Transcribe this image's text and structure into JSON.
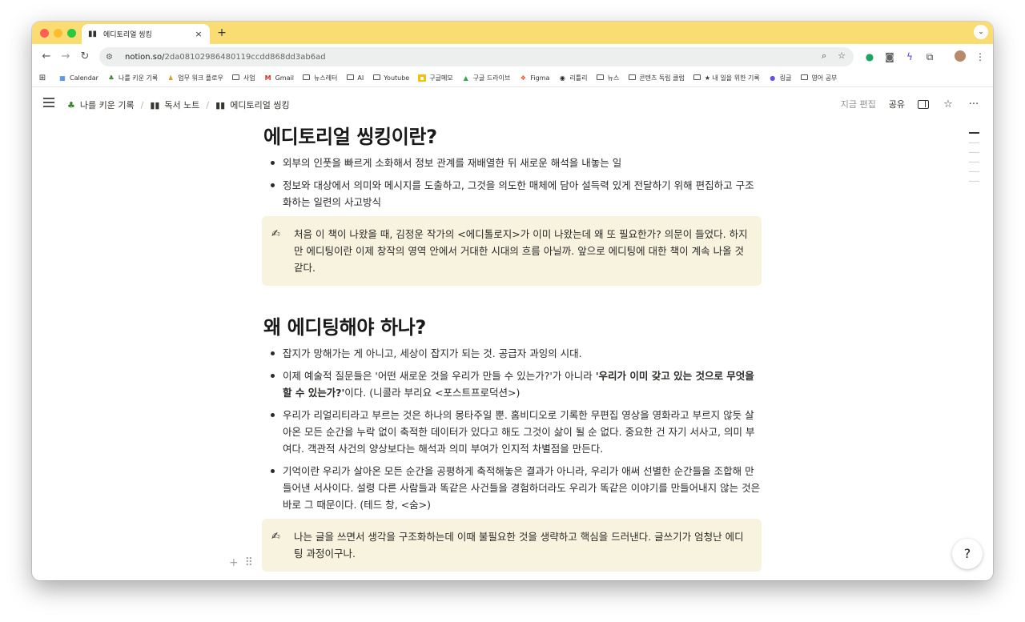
{
  "browser": {
    "tab_title": "에디토리얼 씽킹",
    "url_host": "notion.so/",
    "url_path": "2da08102986480119ccdd868dd3ab6ad",
    "bookmarks": [
      {
        "label": "Calendar",
        "icon": "calendar-icon"
      },
      {
        "label": "나를 키운 기록",
        "icon": "tree-icon"
      },
      {
        "label": "업무 워크 플로우",
        "icon": "worker-icon"
      },
      {
        "label": "사업",
        "icon": "folder-icon"
      },
      {
        "label": "Gmail",
        "icon": "gmail-icon"
      },
      {
        "label": "뉴스레터",
        "icon": "folder-icon"
      },
      {
        "label": "AI",
        "icon": "folder-icon"
      },
      {
        "label": "Youtube",
        "icon": "folder-icon"
      },
      {
        "label": "구글메모",
        "icon": "keep-icon"
      },
      {
        "label": "구글 드라이브",
        "icon": "drive-icon"
      },
      {
        "label": "Figma",
        "icon": "figma-icon"
      },
      {
        "label": "리틀리",
        "icon": "litly-icon"
      },
      {
        "label": "뉴스",
        "icon": "folder-icon"
      },
      {
        "label": "콘텐츠 독립 클럽",
        "icon": "folder-icon"
      },
      {
        "label": "★ 내 일을 위한 기록",
        "icon": "folder-icon"
      },
      {
        "label": "링글",
        "icon": "ringle-icon"
      },
      {
        "label": "영어 공부",
        "icon": "folder-icon"
      }
    ]
  },
  "notion": {
    "breadcrumbs": [
      {
        "label": "나를 키운 기록",
        "icon": "tree-icon"
      },
      {
        "label": "독서 노트",
        "icon": "book-icon"
      },
      {
        "label": "에디토리얼 씽킹",
        "icon": "book-icon"
      }
    ],
    "edited_label": "지금 편집",
    "share_label": "공유"
  },
  "document": {
    "section1": {
      "heading": "에디토리얼 씽킹이란?",
      "bullets": [
        "외부의 인풋을 빠르게 소화해서 정보 관계를 재배열한 뒤 새로운 해석을 내놓는 일",
        "정보와 대상에서 의미와 메시지를 도출하고, 그것을 의도한 매체에 담아 설득력 있게 전달하기 위해 편집하고 구조화하는 일련의 사고방식"
      ],
      "callout": "처음 이 책이 나왔을 때, 김정운 작가의 <에디톨로지>가 이미 나왔는데 왜 또 필요한가? 의문이 들었다. 하지만 에디팅이란 이제 창작의 영역 안에서 거대한 시대의 흐름 아닐까. 앞으로 에디팅에 대한 책이 계속 나올 것 같다."
    },
    "section2": {
      "heading": "왜 에디팅해야 하나?",
      "bullet1": "잡지가 망해가는 게 아니고, 세상이 잡지가 되는 것. 공급자 과잉의 시대.",
      "bullet2_pre": "이제 예술적 질문들은 '어떤 새로운 것을 우리가 만들 수 있는가?'가 아니라 ",
      "bullet2_bold": "'우리가 이미 갖고 있는 것으로 무엇을 할 수 있는가?'",
      "bullet2_post": "이다. (니콜라 부리요 <포스트프로덕션>)",
      "bullet3": "우리가 리얼리티라고 부르는 것은 하나의 몽타주일 뿐. 홈비디오로 기록한 무편집 영상을 영화라고 부르지 않듯 살아온 모든 순간을 누락 없이 축적한 데이터가 있다고 해도 그것이 삶이 될 순 없다. 중요한 건 자기 서사고, 의미 부여다. 객관적 사건의 양상보다는 해석과 의미 부여가 인지적 차별점을 만든다.",
      "bullet4": "기억이란 우리가 살아온 모든 순간을 공평하게 축적해놓은 결과가 아니라, 우리가 애써 선별한 순간들을 조합해 만들어낸 서사이다. 설령 다른 사람들과 똑같은 사건들을 경험하더라도 우리가 똑같은 이야기를 만들어내지 않는 것은 바로 그 때문이다. (테드 창, <숨>)",
      "callout": "나는 글을 쓰면서 생각을 구조화하는데 이때 불필요한 것을 생략하고 핵심을 드러낸다. 글쓰기가 엄청난 에디팅 과정이구나."
    }
  }
}
